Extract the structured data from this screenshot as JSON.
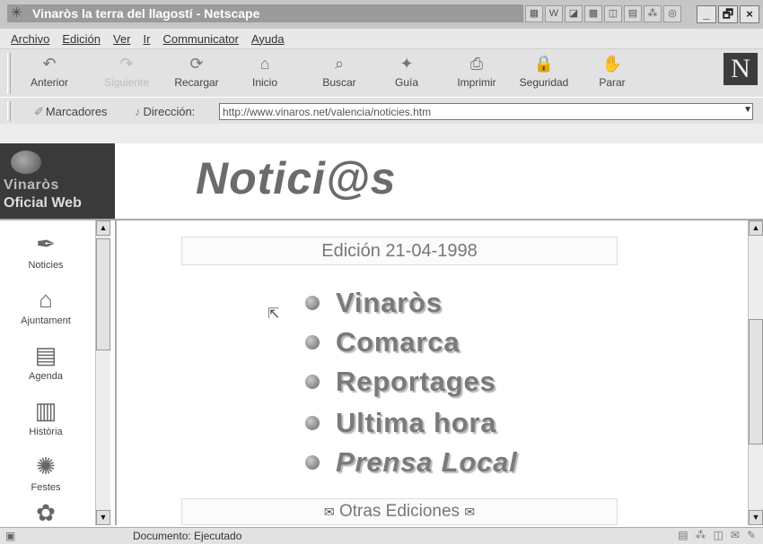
{
  "window": {
    "title": "Vinaròs la terra del llagostí - Netscape",
    "tray_icons": [
      "▦",
      "W",
      "◪",
      "▩",
      "◫",
      "▤",
      "⁂",
      "◎"
    ],
    "minimize": "_",
    "maximize": "🗗",
    "close": "×"
  },
  "menu": [
    "Archivo",
    "Edición",
    "Ver",
    "Ir",
    "Communicator",
    "Ayuda"
  ],
  "toolbar": {
    "buttons": [
      {
        "label": "Anterior",
        "icon": "↶",
        "enabled": true
      },
      {
        "label": "Siguiente",
        "icon": "↷",
        "enabled": false
      },
      {
        "label": "Recargar",
        "icon": "⟳",
        "enabled": true
      },
      {
        "label": "Inicio",
        "icon": "⌂",
        "enabled": true
      },
      {
        "label": "Buscar",
        "icon": "⌕",
        "enabled": true
      },
      {
        "label": "Guía",
        "icon": "✦",
        "enabled": true
      },
      {
        "label": "Imprimir",
        "icon": "⎙",
        "enabled": true
      },
      {
        "label": "Seguridad",
        "icon": "🔒",
        "enabled": true
      },
      {
        "label": "Parar",
        "icon": "✋",
        "enabled": true
      }
    ],
    "logo": "N"
  },
  "location": {
    "bookmarks_label": "Marcadores",
    "address_label": "Dirección:",
    "url": "http://www.vinaros.net/valencia/noticies.htm"
  },
  "site": {
    "logo_line1": "Vinaròs",
    "logo_line2": "Oficial Web",
    "banner_title": "Notici@s"
  },
  "left_nav": [
    {
      "label": "Noticies",
      "icon": "✒"
    },
    {
      "label": "Ajuntament",
      "icon": "⌂"
    },
    {
      "label": "Agenda",
      "icon": "▤"
    },
    {
      "label": "Història",
      "icon": "▥"
    },
    {
      "label": "Festes",
      "icon": "✺"
    },
    {
      "label": "",
      "icon": "✿"
    }
  ],
  "main": {
    "edition": "Edición 21-04-1998",
    "sections": [
      "Vinaròs",
      "Comarca",
      "Reportages",
      "Ultima hora",
      "Prensa Local"
    ],
    "other_editions": "Otras Ediciones",
    "envelope_icon": "✉"
  },
  "status": {
    "text": "Documento: Ejecutado",
    "right_icons": [
      "▤",
      "⁂",
      "◫",
      "✉",
      "✎"
    ]
  }
}
